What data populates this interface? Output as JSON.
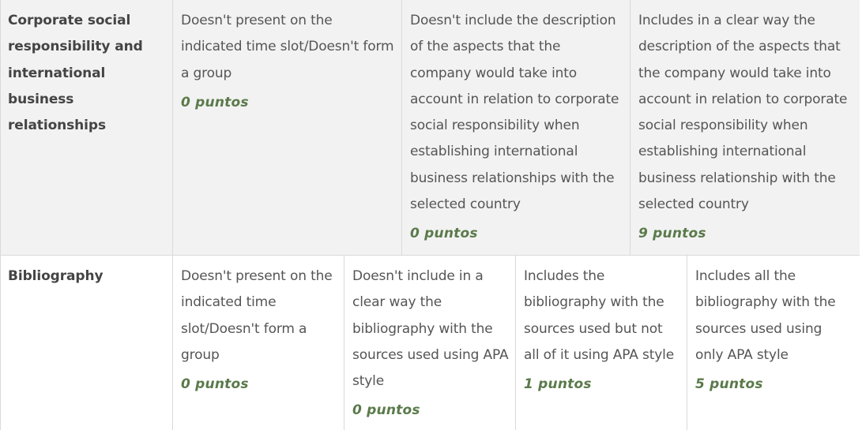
{
  "rubric": {
    "rows": [
      {
        "criterion": "Corporate social responsibility and international business relationships",
        "levels": [
          {
            "description": "Doesn't present on the indicated time slot/Doesn't form a group",
            "points": "0 puntos"
          },
          {
            "description": "Doesn't include the description of the aspects that the company would take into account in relation to corporate social responsibility when establishing international business relationships with the selected country",
            "points": "0 puntos"
          },
          {
            "description": "Includes in a clear way the description of the aspects that the company would take into account in relation to corporate social responsibility when establishing international business relationship with the selected country",
            "points": "9 puntos"
          }
        ]
      },
      {
        "criterion": "Bibliography",
        "levels": [
          {
            "description": "Doesn't present on the indicated time slot/Doesn't form a group",
            "points": "0 puntos"
          },
          {
            "description": "Doesn't include in a clear way the bibliography with the sources used using APA style",
            "points": "0 puntos"
          },
          {
            "description": "Includes the bibliography with the sources used but not all of it using APA style",
            "points": "1 puntos"
          },
          {
            "description": "Includes all the bibliography with the sources used using only APA style",
            "points": "5 puntos"
          }
        ]
      }
    ]
  }
}
